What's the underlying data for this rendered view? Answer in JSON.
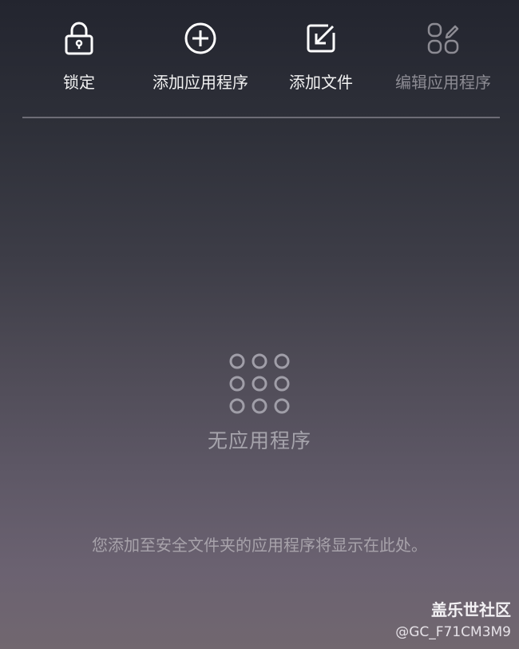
{
  "toolbar": {
    "lock_label": "锁定",
    "add_app_label": "添加应用程序",
    "add_file_label": "添加文件",
    "edit_apps_label": "编辑应用程序",
    "icons": [
      "lock-icon",
      "plus-circle-icon",
      "add-file-icon",
      "edit-apps-icon"
    ]
  },
  "empty_state": {
    "icon": "apps-grid-icon",
    "title": "无应用程序",
    "description": "您添加至安全文件夹的应用程序将显示在此处。"
  },
  "watermark": {
    "site": "盖乐世社区",
    "user": "@GC_F71CM3M9"
  },
  "colors": {
    "text": "#f2f2f2",
    "disabled_text": "#8c8b93",
    "muted_text": "#a6a4ac",
    "divider": "#6d6c76"
  }
}
